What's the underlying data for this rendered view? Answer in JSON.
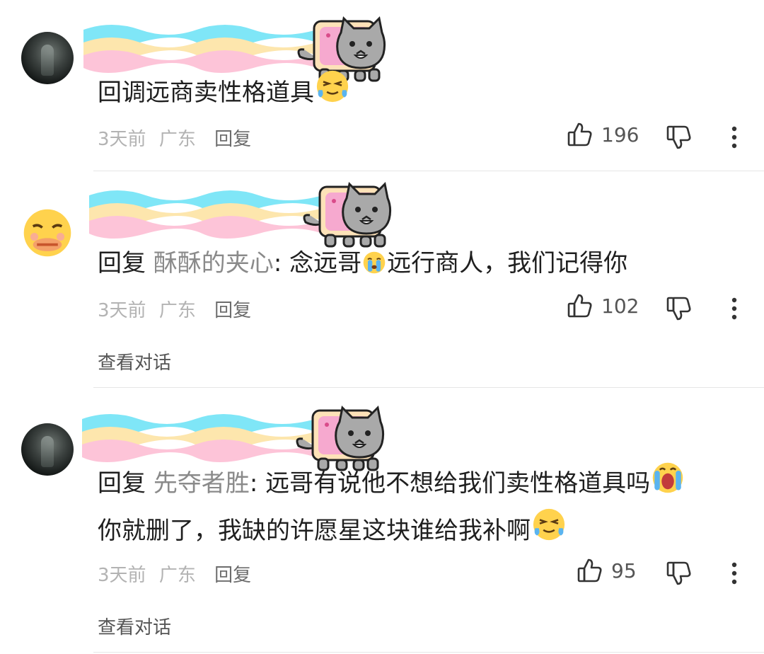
{
  "comments": [
    {
      "text": "回调远商卖性格道具",
      "time": "3天前",
      "region": "广东",
      "reply_label": "回复",
      "likes": "196"
    },
    {
      "reply_prefix": "回复",
      "mention": "酥酥的夹心",
      "text_part1": ": 念远哥",
      "text_part2": "远行商人，我们记得你",
      "time": "3天前",
      "region": "广东",
      "reply_label": "回复",
      "likes": "102",
      "view_conversation": "查看对话"
    },
    {
      "reply_prefix": "回复",
      "mention": "先夺者胜",
      "text_line1": ": 远哥有说他不想给我们卖性格道具吗",
      "text_line2": "你就删了，我缺的许愿星这块谁给我补啊",
      "time": "3天前",
      "region": "广东",
      "reply_label": "回复",
      "likes": "95",
      "view_conversation": "查看对话"
    }
  ],
  "icons": {
    "like": "thumbs-up-icon",
    "dislike": "thumbs-down-icon",
    "more": "more-vertical-icon",
    "nyan": "nyan-cat-badge",
    "emoji_grin_sweat": "laughing-tears-emoji",
    "emoji_crying": "crying-emoji",
    "emoji_screaming": "screaming-emoji",
    "emoji_nauseated": "nauseated-emoji"
  },
  "colors": {
    "text": "#1f1f1f",
    "mention": "#8a8a8a",
    "meta": "#b3b3b3",
    "rainbow_blue": "#7fe6f7",
    "rainbow_yellow": "#fde6ad",
    "rainbow_pink": "#fdc4d8"
  }
}
